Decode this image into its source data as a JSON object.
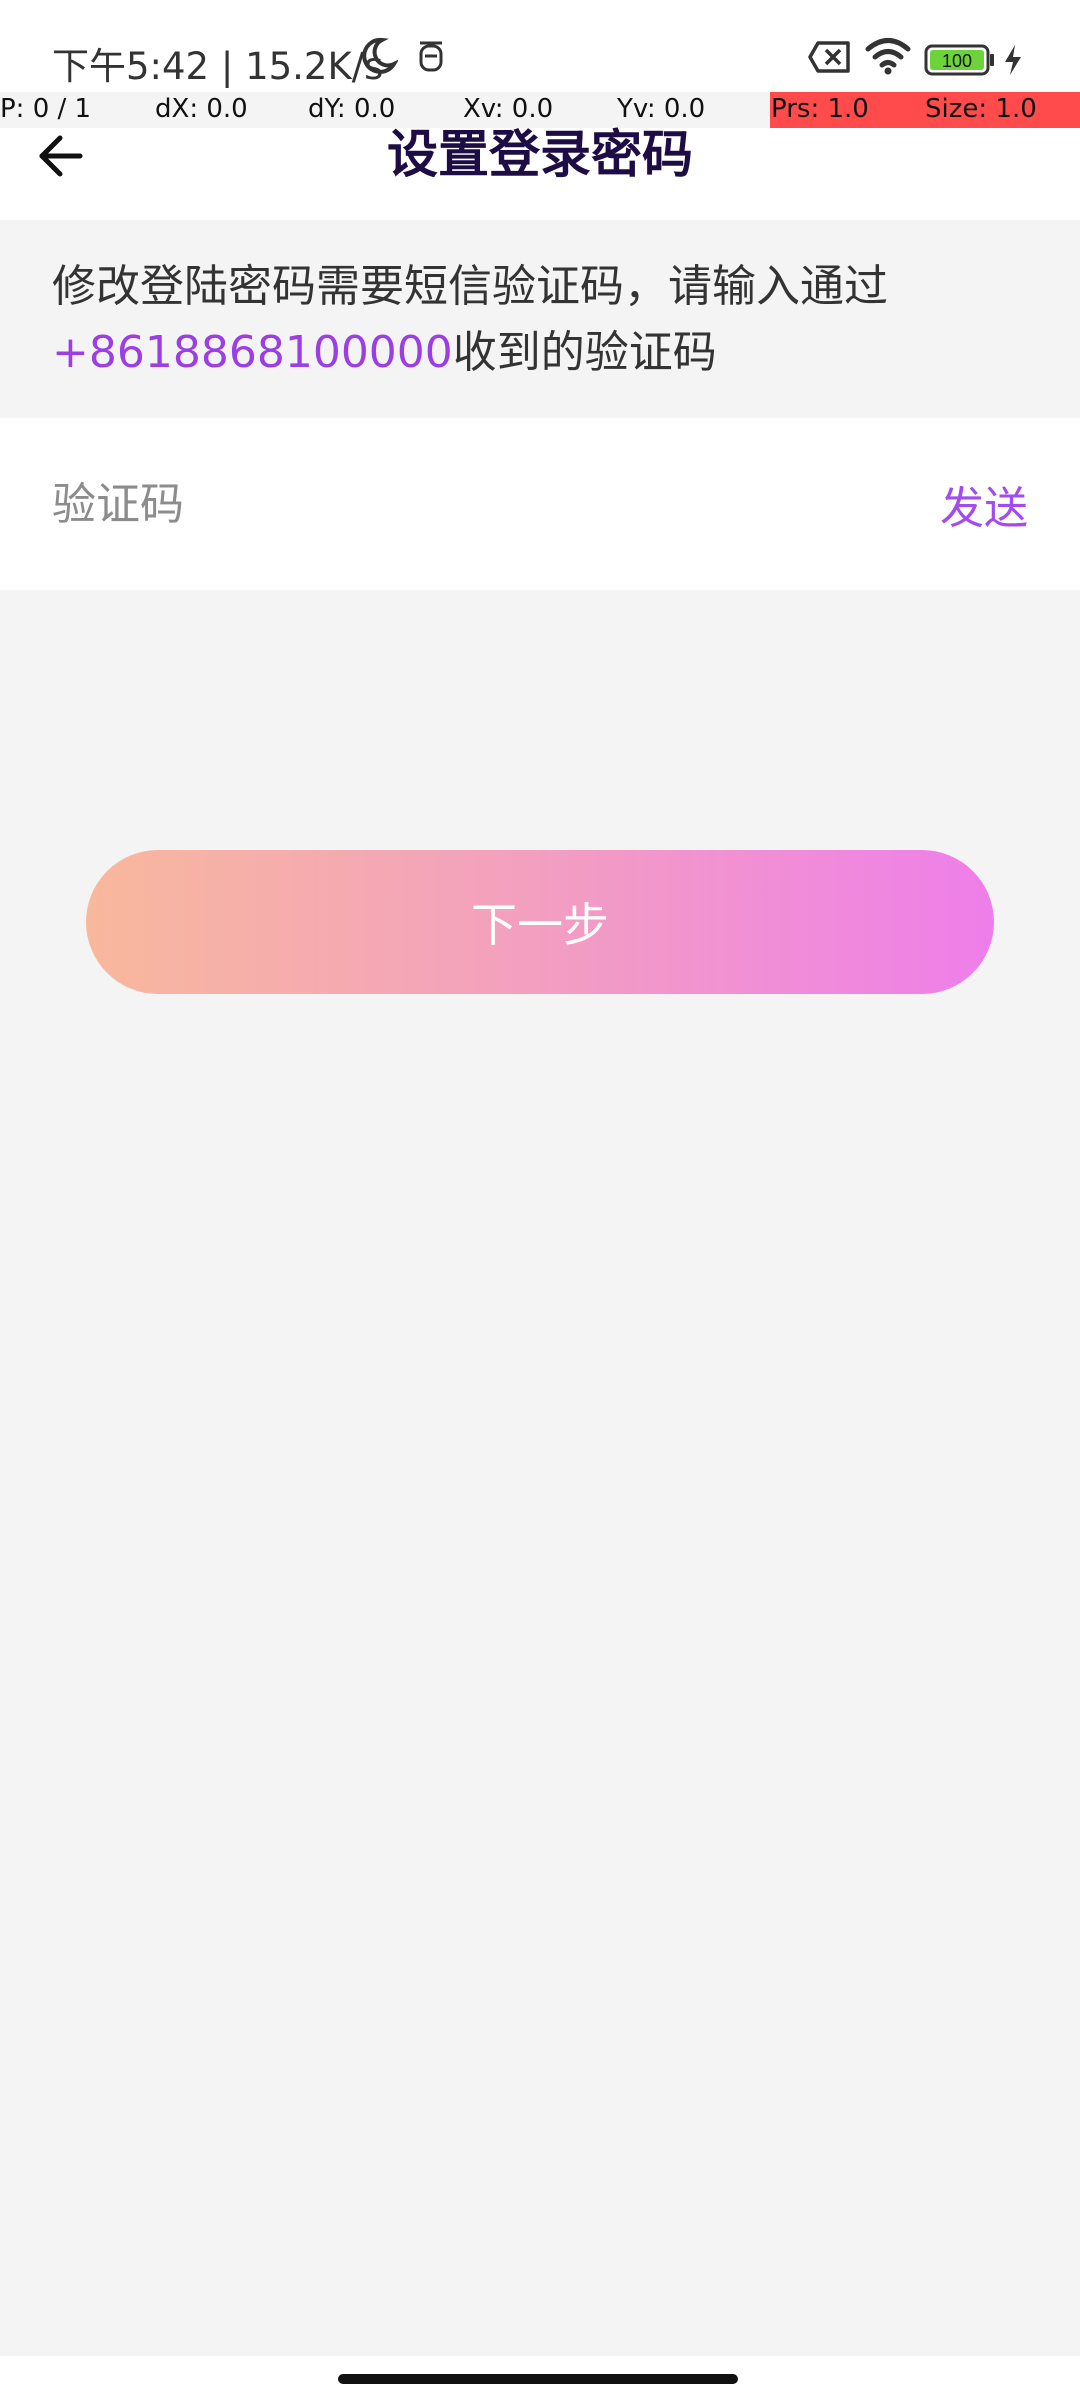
{
  "status_bar": {
    "time_speed": "下午5:42 | 15.2K/s",
    "battery_level": "100",
    "icons": [
      "moon-icon",
      "alarm-icon",
      "sim-off-icon",
      "wifi-icon",
      "battery-icon",
      "charging-icon"
    ]
  },
  "pointer_overlay": {
    "p": "P: 0 / 1",
    "dx": "dX: 0.0",
    "dy": "dY: 0.0",
    "xv": "Xv: 0.0",
    "yv": "Yv: 0.0",
    "prs": "Prs: 1.0",
    "size": "Size: 1.0"
  },
  "header": {
    "back_icon": "arrow-left-icon",
    "title": "设置登录密码"
  },
  "notice": {
    "text_before": "修改登陆密码需要短信验证码，请输入通过",
    "phone": "+8618868100000",
    "text_after": "收到的验证码"
  },
  "code_field": {
    "value": "",
    "placeholder": "验证码",
    "send_label": "发送"
  },
  "next_button": {
    "label": "下一步"
  },
  "colors": {
    "accent": "#a34bf0",
    "title": "#1e0d45",
    "gradient_start": "#f8b89c",
    "gradient_end": "#ee7eea",
    "overlay_red": "#ff4b4b"
  }
}
